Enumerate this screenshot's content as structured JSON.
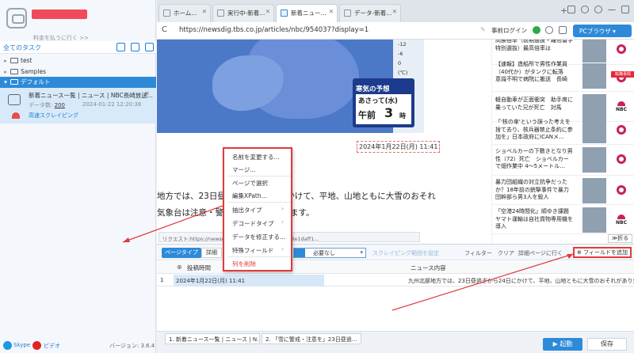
{
  "left": {
    "upgrade": "料金を払うに行く >>",
    "all_tasks": "全てのタスク",
    "tree": [
      {
        "caret": "▸",
        "label": "test"
      },
      {
        "caret": "▸",
        "label": "Samples"
      },
      {
        "caret": "▾",
        "label": "デフォルト"
      }
    ],
    "task": {
      "title": "新着ニュース一覧 | ニュース | NBC長崎放送...",
      "count_label": "データ数:",
      "count": "200",
      "time": "2024-01-22 12:20:38",
      "mode": "高速スクレイピング"
    },
    "footer": {
      "skype": "Skype",
      "video": "ビデオ",
      "version": "バージョン: 3.6.4"
    }
  },
  "browser": {
    "tabs": [
      {
        "label": "ホーム..."
      },
      {
        "label": "実行中-新着..."
      },
      {
        "label": "新着ニュー..."
      },
      {
        "label": "データ-新着..."
      }
    ],
    "new_tab": "+",
    "reload": "C",
    "url": "https://newsdig.tbs.co.jp/articles/nbc/954037?display=1",
    "pre_login": "事前ログイン",
    "pc_browser": "PCブラウザ ▾"
  },
  "page": {
    "legend": [
      "-12",
      "-6",
      "0",
      "(℃)"
    ],
    "forecast_title": "寒気の予想",
    "forecast_date": "あさって(水)",
    "forecast_am": "午前",
    "forecast_val": "3",
    "forecast_unit": "時",
    "pub_date": "2024年1月22日(月) 11:41",
    "body_line1": "地方では、23日昼過ぎから24日にかけて、平地、山地ともに大雪のおそれ",
    "body_line2": "気象台は注意・警戒を呼びかけています。",
    "xpath": "リクエスト:https://newsdig...img_4abbadb76fd6578e1daff1...",
    "collapse": "≫折る",
    "ad_badge": "転職事情",
    "news": [
      {
        "text": "高勝宿率（前期選抜・離島留学特別選抜）最高倍率は"
      },
      {
        "text": "【速報】造船所で男性作業員（40代か）がタンクに転落　意識不明で病院に搬送　長崎"
      },
      {
        "text": "軽自動車が正面衝突　助手席に乗っていた兄が死亡　対馬"
      },
      {
        "text": "「'核の傘'という誤った考えを捨て去り、核兵器禁止条約に参加を」日本政府にICANメ…"
      },
      {
        "text": "ショベルカーの下敷きとなり男性（72）死亡　ショベルカーで畑作業中 4～5メートル…"
      },
      {
        "text": "暴力団組織の対立抗争だったか？18年前の銃撃事件で暴力団幹部ら男3人を殺人"
      },
      {
        "text": "「空港24時間化」順ゆき課題ヤマト運輸は自社貨物専用機を導入"
      }
    ]
  },
  "context_menu": {
    "items": [
      "名前を変更する...",
      "マージ...",
      "ページで選択",
      "編集XPath...",
      "抽出タイプ",
      "デコードタイプ",
      "データを修正する...",
      "特殊フィールド",
      "列を削除"
    ]
  },
  "datapanel": {
    "page_type": "ページタイプ",
    "detail": "詳細",
    "sel_tag": "",
    "sel_value": "必要なし",
    "scroll_range": "スクレイピング範囲を設定",
    "filter": "フィルター",
    "clear": "クリア",
    "detail_page": "詳細ページに行く",
    "add_field": "⊕ フィールドを追加",
    "columns": [
      "投稿時間",
      "ニュース内容"
    ],
    "row": {
      "num": "1",
      "time": "2024年1月22日(月) 11:41",
      "content": "九州北部地方では、23日昼過ぎから24日にかけて、平地、山地ともに大雪のおそれがあり気..."
    }
  },
  "bottom": {
    "tabs": [
      "1. 新着ニュース一覧 | ニュース | N...",
      "2. 「雪に警戒・注意を」23日昼過..."
    ],
    "run": "▶ 起動",
    "save": "保存"
  }
}
